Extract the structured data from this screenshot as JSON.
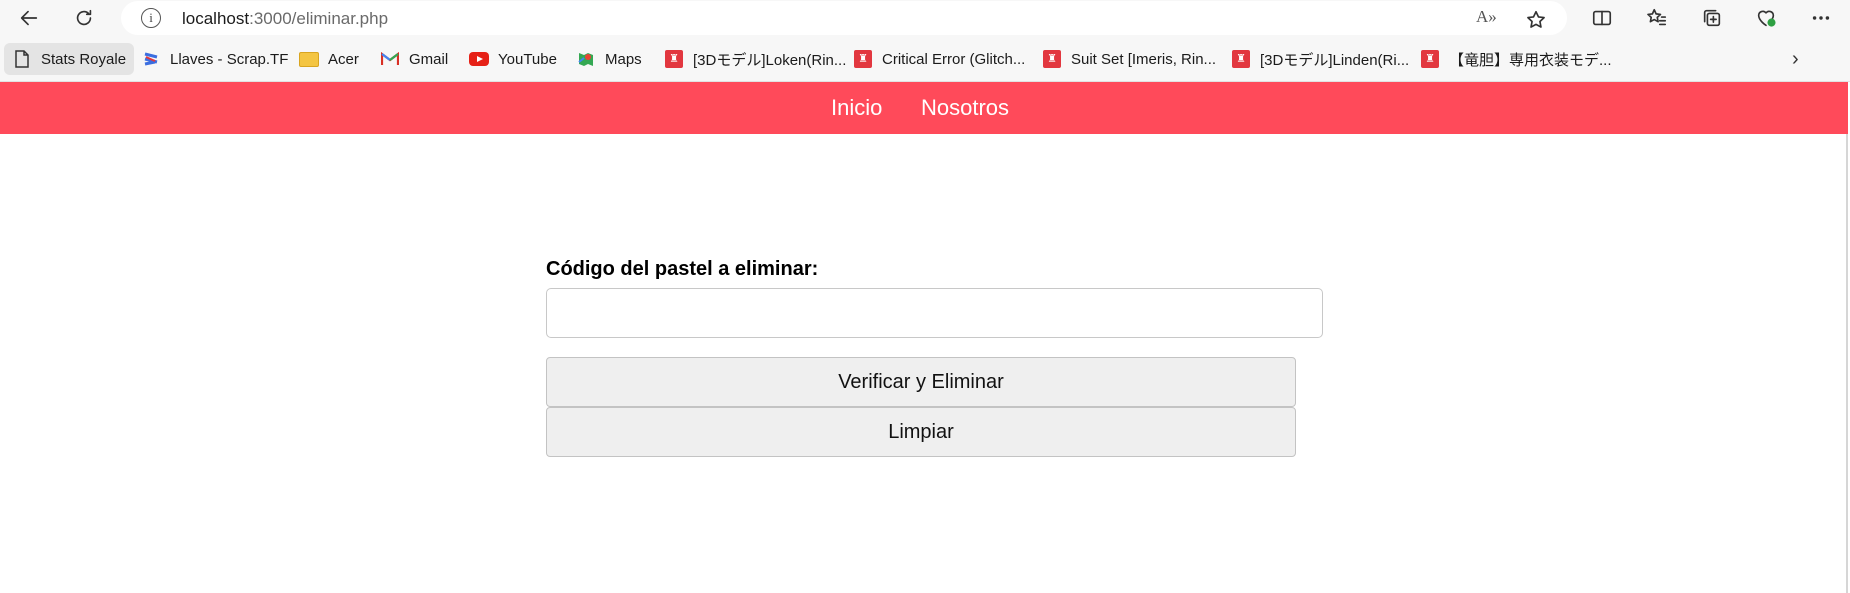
{
  "browser": {
    "url_host": "localhost",
    "url_path": ":3000/eliminar.php",
    "read_aloud_label": "A»"
  },
  "bookmarks": [
    {
      "label": "Stats Royale",
      "icon": "page-icon"
    },
    {
      "label": "Llaves - Scrap.TF",
      "icon": "scraptf-icon"
    },
    {
      "label": "Acer",
      "icon": "folder-icon"
    },
    {
      "label": "Gmail",
      "icon": "gmail-icon"
    },
    {
      "label": "YouTube",
      "icon": "youtube-icon"
    },
    {
      "label": "Maps",
      "icon": "maps-icon"
    },
    {
      "label": "[3Dモデル]Loken(Rin...",
      "icon": "booth-icon"
    },
    {
      "label": "Critical Error (Glitch...",
      "icon": "booth-icon"
    },
    {
      "label": "Suit Set [Imeris, Rin...",
      "icon": "booth-icon"
    },
    {
      "label": "[3Dモデル]Linden(Ri...",
      "icon": "booth-icon"
    },
    {
      "label": "【竜胆】専用衣装モデ...",
      "icon": "booth-icon"
    }
  ],
  "page": {
    "nav": {
      "inicio": "Inicio",
      "nosotros": "Nosotros"
    },
    "form": {
      "label": "Código del pastel a eliminar:",
      "input_value": "",
      "verify_button": "Verificar y Eliminar",
      "clear_button": "Limpiar"
    }
  },
  "colors": {
    "navbar": "#ff4a5a",
    "nav_text": "#ffffff",
    "button_bg": "#efefef"
  }
}
